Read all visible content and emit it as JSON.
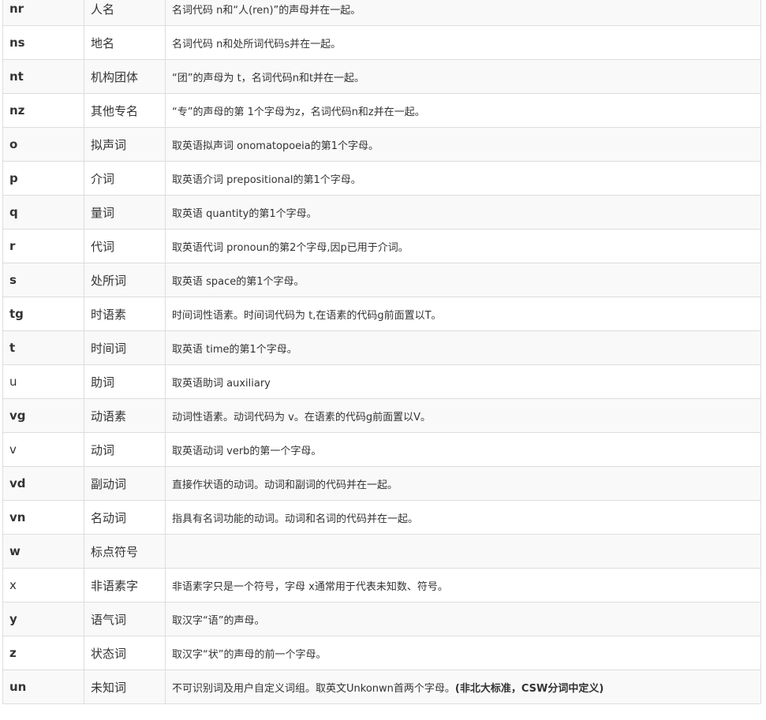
{
  "rows": [
    {
      "code": "nr",
      "bold": true,
      "name": "人名",
      "desc": "名词代码 n和“人(ren)”的声母并在一起。"
    },
    {
      "code": "ns",
      "bold": true,
      "name": "地名",
      "desc": "名词代码 n和处所词代码s并在一起。"
    },
    {
      "code": "nt",
      "bold": true,
      "name": "机构团体",
      "desc": "“团”的声母为 t，名词代码n和t并在一起。"
    },
    {
      "code": "nz",
      "bold": true,
      "name": "其他专名",
      "desc": "“专”的声母的第 1个字母为z，名词代码n和z并在一起。"
    },
    {
      "code": "o",
      "bold": true,
      "name": "拟声词",
      "desc": "取英语拟声词 onomatopoeia的第1个字母。"
    },
    {
      "code": "p",
      "bold": true,
      "name": "介词",
      "desc": "取英语介词 prepositional的第1个字母。"
    },
    {
      "code": "q",
      "bold": true,
      "name": "量词",
      "desc": "取英语 quantity的第1个字母。"
    },
    {
      "code": "r",
      "bold": true,
      "name": "代词",
      "desc": "取英语代词 pronoun的第2个字母,因p已用于介词。"
    },
    {
      "code": "s",
      "bold": true,
      "name": "处所词",
      "desc": "取英语 space的第1个字母。"
    },
    {
      "code": "tg",
      "bold": true,
      "name": "时语素",
      "desc": "时间词性语素。时间词代码为 t,在语素的代码g前面置以T。"
    },
    {
      "code": "t",
      "bold": true,
      "name": "时间词",
      "desc": "取英语 time的第1个字母。"
    },
    {
      "code": "u",
      "bold": false,
      "name": "助词",
      "desc": "取英语助词 auxiliary"
    },
    {
      "code": "vg",
      "bold": true,
      "name": "动语素",
      "desc": "动词性语素。动词代码为 v。在语素的代码g前面置以V。"
    },
    {
      "code": "v",
      "bold": false,
      "name": "动词",
      "desc": "取英语动词 verb的第一个字母。"
    },
    {
      "code": "vd",
      "bold": true,
      "name": "副动词",
      "desc": "直接作状语的动词。动词和副词的代码并在一起。"
    },
    {
      "code": "vn",
      "bold": true,
      "name": "名动词",
      "desc": "指具有名词功能的动词。动词和名词的代码并在一起。"
    },
    {
      "code": "w",
      "bold": true,
      "name": "标点符号",
      "desc": ""
    },
    {
      "code": "x",
      "bold": false,
      "name": "非语素字",
      "desc": "非语素字只是一个符号，字母 x通常用于代表未知数、符号。"
    },
    {
      "code": "y",
      "bold": true,
      "name": "语气词",
      "desc": "取汉字“语”的声母。"
    },
    {
      "code": "z",
      "bold": true,
      "name": "状态词",
      "desc": "取汉字“状”的声母的前一个字母。"
    },
    {
      "code": "un",
      "bold": true,
      "name": "未知词",
      "desc": "不可识别词及用户自定义词组。取英文Unkonwn首两个字母。",
      "note": "(非北大标准，CSW分词中定义)"
    }
  ]
}
